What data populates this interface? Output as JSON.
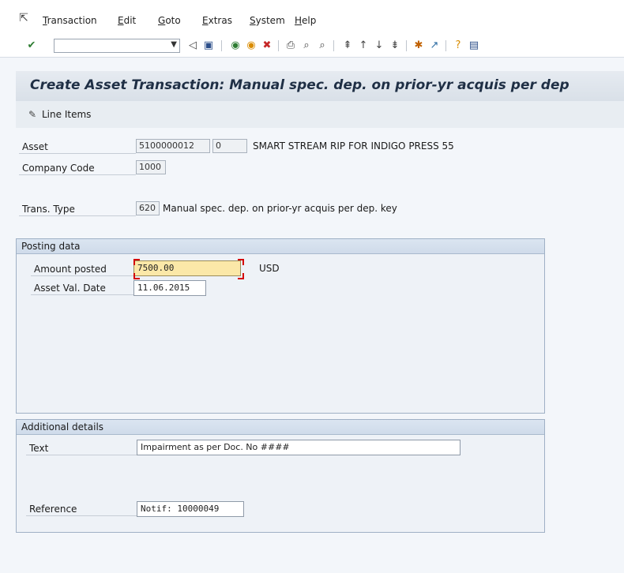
{
  "menu": {
    "items": [
      "Transaction",
      "Edit",
      "Goto",
      "Extras",
      "System",
      "Help"
    ]
  },
  "toolbar": {
    "command_field_value": ""
  },
  "title": "Create Asset Transaction: Manual spec. dep. on prior-yr acquis per dep",
  "app_toolbar": {
    "line_items_label": "Line Items"
  },
  "header_fields": {
    "asset_label": "Asset",
    "asset_number": "5100000012",
    "asset_subnumber": "0",
    "asset_description": "SMART STREAM RIP FOR INDIGO PRESS 55",
    "company_code_label": "Company Code",
    "company_code": "1000",
    "trans_type_label": "Trans. Type",
    "trans_type_code": "620",
    "trans_type_description": "Manual spec. dep. on prior-yr acquis per dep. key"
  },
  "posting_data": {
    "title": "Posting data",
    "amount_label": "Amount posted",
    "amount_value": "7500.00",
    "currency": "USD",
    "value_date_label": "Asset Val. Date",
    "value_date": "11.06.2015"
  },
  "additional_details": {
    "title": "Additional details",
    "text_label": "Text",
    "text_value": "Impairment as per Doc. No ####",
    "reference_label": "Reference",
    "reference_value": "Notif: 10000049"
  },
  "colors": {
    "focus_field": "#fbe8a8",
    "title_text": "#1f2f45",
    "group_header": "#cfdbea"
  }
}
